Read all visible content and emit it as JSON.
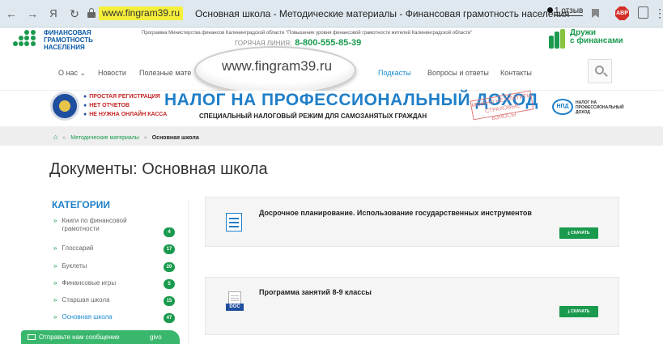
{
  "browser": {
    "url": "www.fingram39.ru",
    "tab_title": "Основная школа - Методические материалы - Финансовая грамотность населения",
    "reviews": "1 отзыв",
    "abp": "ABP",
    "icons": [
      "back-icon",
      "forward-icon",
      "yandex-icon",
      "reload-icon",
      "lock-icon",
      "bookmark-icon",
      "adblock-icon",
      "extension-icon",
      "menu-icon"
    ]
  },
  "header": {
    "logo_lines": [
      "ФИНАНСОВАЯ",
      "ГРАМОТНОСТЬ",
      "НАСЕЛЕНИЯ"
    ],
    "tagline": "Программа Министерства финансов Калининградской области \"Повышение уровня финансовой грамотности жителей Калининградской области\"",
    "hotline_label": "ГОРЯЧАЯ ЛИНИЯ:",
    "hotline_number": "8-800-555-85-39",
    "partner_line1": "Дружи",
    "partner_line2": "с финансами"
  },
  "nav": {
    "items": [
      "О нас",
      "Новости",
      "Полезные мате",
      "Подкасты",
      "Вопросы и ответы",
      "Контакты"
    ],
    "active": "Подкасты"
  },
  "zoom": {
    "text": "www.fingram39.ru"
  },
  "banner": {
    "bullets": [
      "ПРОСТАЯ РЕГИСТРАЦИЯ",
      "НЕТ ОТЧЕТОВ",
      "НЕ НУЖНА ОНЛАЙН КАССА"
    ],
    "title": "НАЛОГ НА ПРОФЕССИОНАЛЬНЫЙ ДОХОД",
    "subtitle": "СПЕЦИАЛЬНЫЙ НАЛОГОВЫЙ РЕЖИМ ДЛЯ САМОЗАНЯТЫХ ГРАЖДАН",
    "stamp": "МОЖНО НЕ ПЛАТИТЬ СТРАХОВЫЕ ВЗНОСЫ",
    "npd": "НПД",
    "npd_text": [
      "НАЛОГ НА",
      "ПРОФЕССИОНАЛЬНЫЙ",
      "ДОХОД"
    ]
  },
  "breadcrumb": {
    "link": "Методические материалы",
    "current": "Основная школа"
  },
  "page": {
    "title": "Документы: Основная школа"
  },
  "sidebar": {
    "title": "КАТЕГОРИИ",
    "items": [
      {
        "label": "Книги по финансовой грамотности",
        "count": "4"
      },
      {
        "label": "Глоссарий",
        "count": "17"
      },
      {
        "label": "Буклеты",
        "count": "20"
      },
      {
        "label": "Финансовые игры",
        "count": "5"
      },
      {
        "label": "Старшая школа",
        "count": "15"
      },
      {
        "label": "Основная школа",
        "count": "47"
      }
    ],
    "active_index": 5
  },
  "documents": [
    {
      "title": "Досрочное планирование. Использование государственных инструментов",
      "button": "СКАЧАТЬ",
      "icon": "document-icon"
    },
    {
      "title": "Программа занятий 8-9 классы",
      "button": "СКАЧАТЬ",
      "icon": "doc-file-icon",
      "icon_label": "DOC"
    }
  ],
  "chat": {
    "text": "Отправьте нам сообщение",
    "extra": "ɡivo"
  }
}
